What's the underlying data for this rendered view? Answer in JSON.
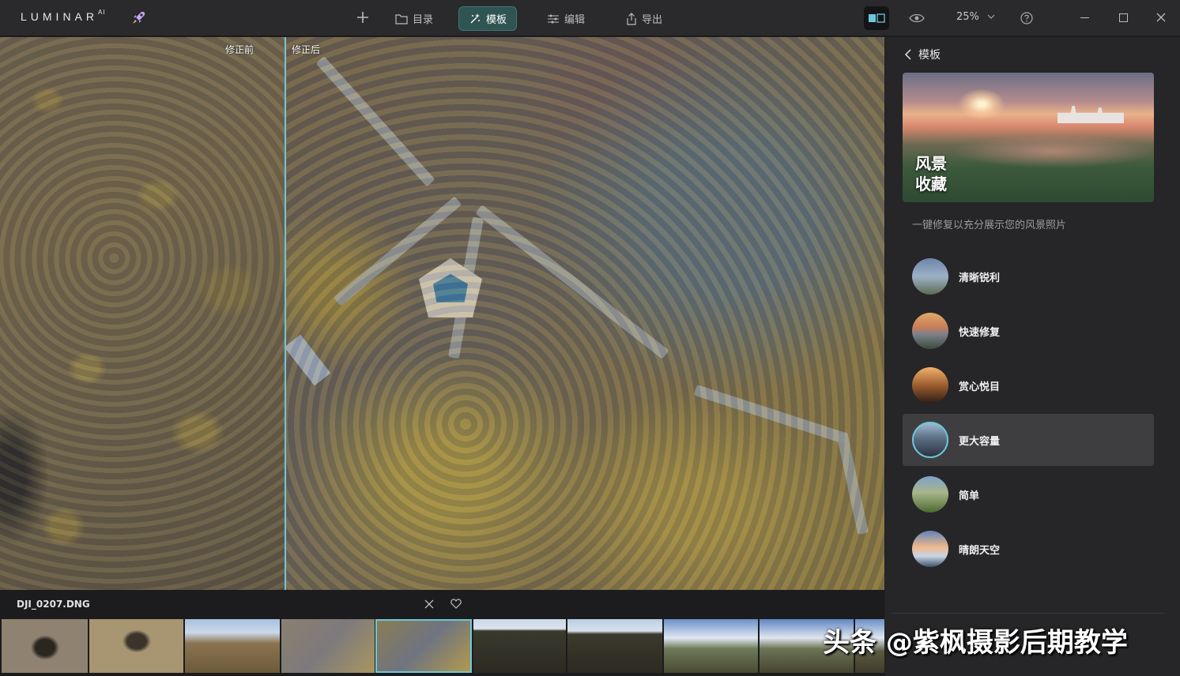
{
  "app": {
    "logo": "LUMINAR",
    "logo_sup": "AI",
    "accent": "#6cc8d8",
    "active_tab_bg": "#2f5452"
  },
  "toolbar": {
    "add_icon": "plus-icon",
    "tabs": [
      {
        "label": "目录",
        "icon": "folder-icon",
        "active": false
      },
      {
        "label": "模板",
        "icon": "sparkle-icon",
        "active": true
      },
      {
        "label": "编辑",
        "icon": "sliders-icon",
        "active": false
      },
      {
        "label": "导出",
        "icon": "share-icon",
        "active": false
      }
    ],
    "zoom": "25%"
  },
  "canvas": {
    "before_label": "修正前",
    "after_label": "修正后"
  },
  "panel": {
    "title": "模板",
    "hero_title_line1": "风景",
    "hero_title_line2": "收藏",
    "description": "一键修复以充分展示您的风景照片",
    "presets": [
      {
        "label": "清晰锐利",
        "selected": false
      },
      {
        "label": "快速修复",
        "selected": false
      },
      {
        "label": "赏心悦目",
        "selected": false
      },
      {
        "label": "更大容量",
        "selected": true
      },
      {
        "label": "简单",
        "selected": false
      },
      {
        "label": "晴朗天空",
        "selected": false
      }
    ]
  },
  "filmstrip": {
    "filename": "DJI_0207.DNG",
    "selected_index": 4,
    "frame_count": 10
  },
  "watermark": "头条 @紫枫摄影后期教学"
}
